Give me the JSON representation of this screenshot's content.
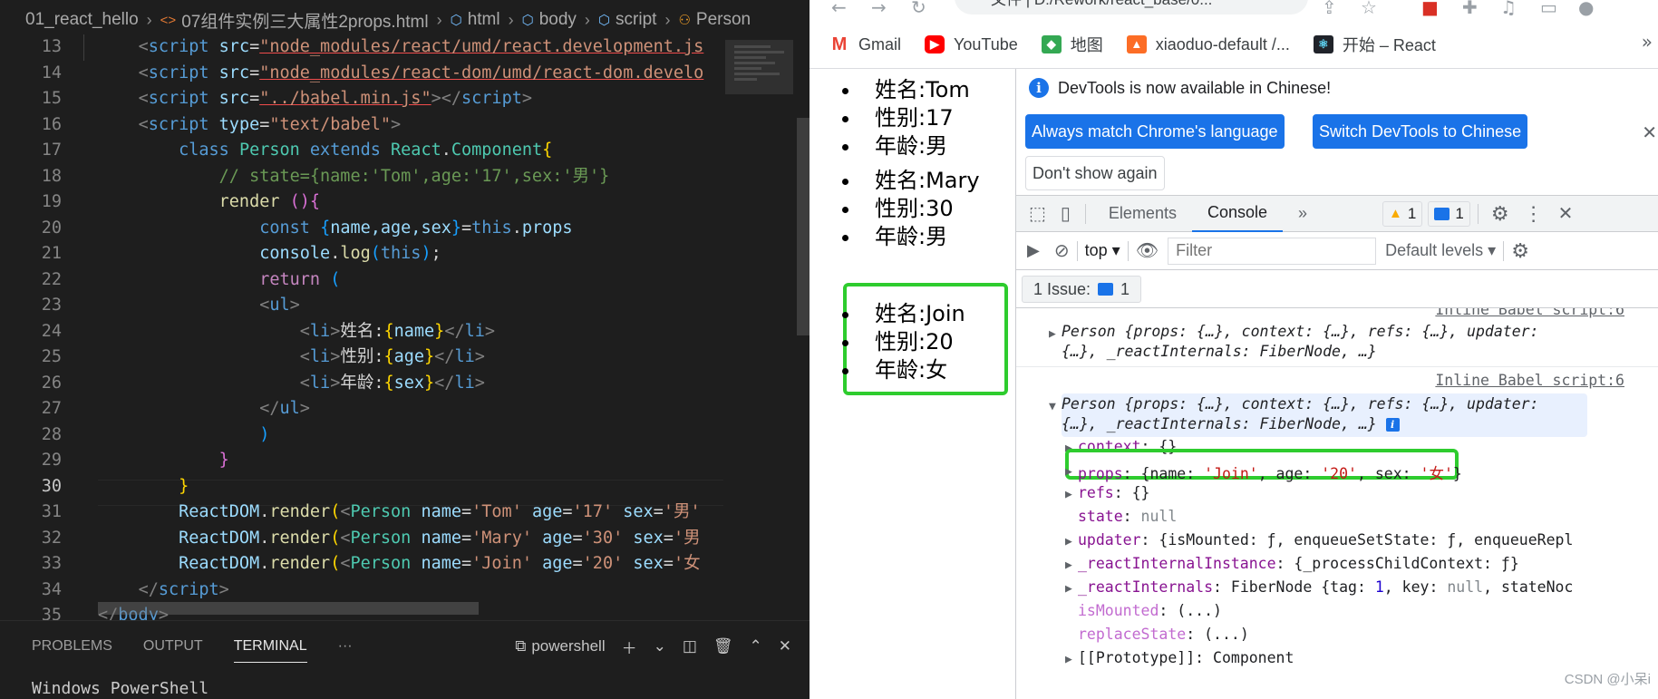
{
  "vscode": {
    "breadcrumb": {
      "project": "01_react_hello",
      "file": "07组件实例三大属性2props.html",
      "html": "html",
      "body": "body",
      "script": "script",
      "person": "Person"
    },
    "panel": {
      "tabs": [
        "PROBLEMS",
        "OUTPUT",
        "TERMINAL"
      ],
      "more": "···",
      "shell": "powershell",
      "terminal_output": "Windows PowerShell"
    },
    "line_numbers": [
      "13",
      "14",
      "15",
      "16",
      "17",
      "18",
      "19",
      "20",
      "21",
      "22",
      "23",
      "24",
      "25",
      "26",
      "27",
      "28",
      "29",
      "30",
      "31",
      "32",
      "33",
      "34",
      "35"
    ],
    "code": {
      "l13_src": "\"node_modules/react/umd/react.development.js",
      "l14_src": "\"node_modules/react-dom/umd/react-dom.develo",
      "l15_src": "\"../babel.min.js\"",
      "l16_type": "\"text/babel\"",
      "l17_class": "Person",
      "l17_extends": "React",
      "l17_component": "Component",
      "l18_comment": "// state={name:'Tom',age:'17',sex:'男'}",
      "l19_fn": "render",
      "l20_vars": "name,age,sex",
      "l24_label": "姓名:",
      "l24_var": "name",
      "l25_label": "性别:",
      "l25_var": "age",
      "l26_label": "年龄:",
      "l26_var": "sex",
      "l31_props": [
        "'Tom'",
        "'17'",
        "'男'"
      ],
      "l32_props": [
        "'Mary'",
        "'30'",
        "'男"
      ],
      "l33_props": [
        "'Join'",
        "'20'",
        "'女"
      ]
    }
  },
  "chrome": {
    "address": "文件 | D:/Rework/react_base/0...",
    "bookmarks": [
      "Gmail",
      "YouTube",
      "地图",
      "xiaoduo-default /...",
      "开始 – React"
    ],
    "bookmarks_more": "»",
    "page": {
      "persons": [
        {
          "name": "姓名:Tom",
          "age": "性别:17",
          "sex": "年龄:男"
        },
        {
          "name": "姓名:Mary",
          "age": "性别:30",
          "sex": "年龄:男"
        },
        {
          "name": "姓名:Join",
          "age": "性别:20",
          "sex": "年龄:女"
        }
      ]
    },
    "devtools": {
      "notice": "DevTools is now available in Chinese!",
      "btn_match": "Always match Chrome's language",
      "btn_switch": "Switch DevTools to Chinese",
      "btn_dont_show": "Don't show again",
      "tabs": [
        "Elements",
        "Console"
      ],
      "more_tabs": "»",
      "warning_count": "1",
      "message_count": "1",
      "context": "top",
      "filter_placeholder": "Filter",
      "levels": "Default levels",
      "issues_label": "1 Issue:",
      "issues_count": "1",
      "console": {
        "src1": "Inline Babel script:6",
        "src2": "Inline Babel script:6",
        "log1_line1": "Person {props: {…}, context: {…}, refs: {…}, updater:",
        "log1_line2": "{…}, _reactInternals: FiberNode, …}",
        "log2_line1": "Person {props: {…}, context: {…}, refs: {…}, updater:",
        "log2_line2": "{…}, _reactInternals: FiberNode, …}",
        "context_key": "context",
        "context_val": "{}",
        "props_key": "props",
        "props_name": "'Join'",
        "props_age": "'20'",
        "props_sex": "'女'",
        "refs_key": "refs",
        "refs_val": "{}",
        "state_key": "state",
        "state_val": "null",
        "updater_key": "updater",
        "updater_val": "{isMounted: ƒ, enqueueSetState: ƒ, enqueueRepl",
        "rii_key": "_reactInternalInstance",
        "rii_val": "{_processChildContext: ƒ}",
        "ri_key": "_reactInternals",
        "ri_val_pre": "FiberNode {tag: ",
        "ri_val_num": "1",
        "ri_val_post": ", key: ",
        "ri_val_null": "null",
        "ri_val_end": ", stateNoc",
        "ismounted_key": "isMounted",
        "replacestate_key": "replaceState",
        "getter_val": "(...)",
        "proto_key": "[[Prototype]]",
        "proto_val": "Component"
      }
    },
    "watermark": "CSDN @小呆i"
  },
  "colors": {
    "highlight_green": "#2ecc2e",
    "devtools_blue": "#1a73e8"
  }
}
